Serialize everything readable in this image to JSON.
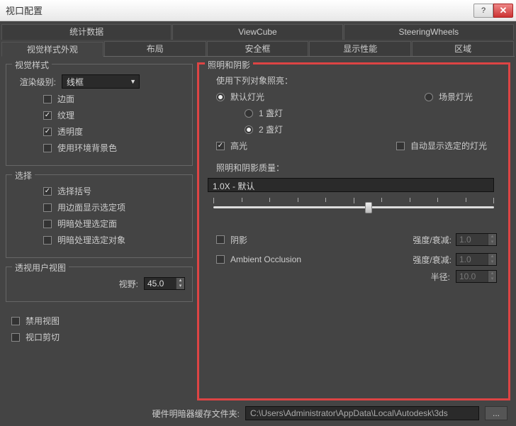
{
  "window": {
    "title": "视口配置"
  },
  "top_tabs": [
    "统计数据",
    "ViewCube",
    "SteeringWheels"
  ],
  "sub_tabs": [
    "视觉样式外观",
    "布局",
    "安全框",
    "显示性能",
    "区域"
  ],
  "visual_style": {
    "group": "视觉样式",
    "render_level_label": "渲染级别:",
    "render_level_value": "线框",
    "edges": "边面",
    "textures": "纹理",
    "transparency": "透明度",
    "env_bg": "使用环境背景色"
  },
  "selection": {
    "group": "选择",
    "brackets": "选择括号",
    "edge_display": "用边面显示选定项",
    "shade_faces": "明暗处理选定面",
    "shade_objects": "明暗处理选定对象"
  },
  "perspective": {
    "group": "透视用户视图",
    "fov_label": "视野:",
    "fov_value": "45.0"
  },
  "bottom": {
    "disable_viewport": "禁用视图",
    "viewport_clipping": "视口剪切"
  },
  "lighting": {
    "group": "照明和阴影",
    "use_label": "使用下列对象照亮：",
    "default_lights": "默认灯光",
    "scene_lights": "场景灯光",
    "one_light": "1 盏灯",
    "two_lights": "2 盏灯",
    "specular": "高光",
    "auto_display": "自动显示选定的灯光",
    "quality_label": "照明和阴影质量：",
    "quality_value": "1.0X - 默认",
    "shadows": "阴影",
    "ao": "Ambient Occlusion",
    "intensity_label": "强度/衰减:",
    "radius_label": "半径:",
    "val_1_0": "1.0",
    "val_10_0": "10.0"
  },
  "footer": {
    "cache_label": "硬件明暗器缓存文件夹:",
    "cache_path": "C:\\Users\\Administrator\\AppData\\Local\\Autodesk\\3ds",
    "browse": "..."
  }
}
